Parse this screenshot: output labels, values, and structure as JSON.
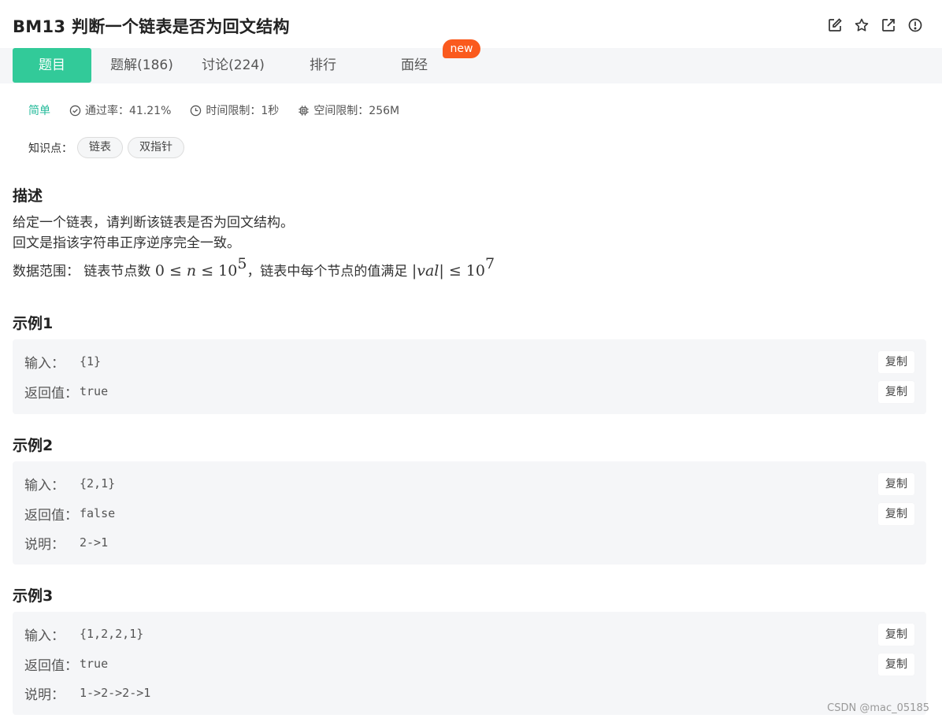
{
  "header": {
    "title": "BM13  判断一个链表是否为回文结构",
    "icons": [
      "edit-icon",
      "star-icon",
      "external-link-icon",
      "info-icon"
    ]
  },
  "tabs": [
    {
      "label": "题目",
      "active": true
    },
    {
      "label": "题解(186)"
    },
    {
      "label": "讨论(224)"
    },
    {
      "label": "排行"
    },
    {
      "label": "面经"
    }
  ],
  "new_badge": "new",
  "meta": {
    "difficulty": "简单",
    "pass_rate": "通过率：41.21%",
    "time_limit": "时间限制：1秒",
    "space_limit": "空间限制：256M"
  },
  "knowledge": {
    "label": "知识点：",
    "tags": [
      "链表",
      "双指针"
    ]
  },
  "description": {
    "title": "描述",
    "line1": "给定一个链表，请判断该链表是否为回文结构。",
    "line2": "回文是指该字符串正序逆序完全一致。",
    "range_prefix": "数据范围：  链表节点数 ",
    "range_math1": "0 ≤ ",
    "range_n": "n",
    "range_math2": " ≤ 10",
    "range_exp1": "5",
    "range_mid": "，链表中每个节点的值满足 ",
    "range_abs": "|",
    "range_val": "val",
    "range_abs2": "|",
    "range_math3": " ≤ 10",
    "range_exp2": "7"
  },
  "examples": [
    {
      "title": "示例1",
      "input_label": "输入：",
      "input": "{1}",
      "output_label": "返回值：",
      "output": "true",
      "copy": "复制"
    },
    {
      "title": "示例2",
      "input_label": "输入：",
      "input": "{2,1}",
      "output_label": "返回值：",
      "output": "false",
      "note_label": "说明：",
      "note": "2->1",
      "copy": "复制"
    },
    {
      "title": "示例3",
      "input_label": "输入：",
      "input": "{1,2,2,1}",
      "output_label": "返回值：",
      "output": "true",
      "note_label": "说明：",
      "note": "1->2->2->1",
      "copy": "复制"
    }
  ],
  "watermark": "CSDN @mac_05185",
  "colors": {
    "accent": "#32ca99",
    "difficulty": "#25bb9b",
    "badge": "#fa5a1e"
  }
}
